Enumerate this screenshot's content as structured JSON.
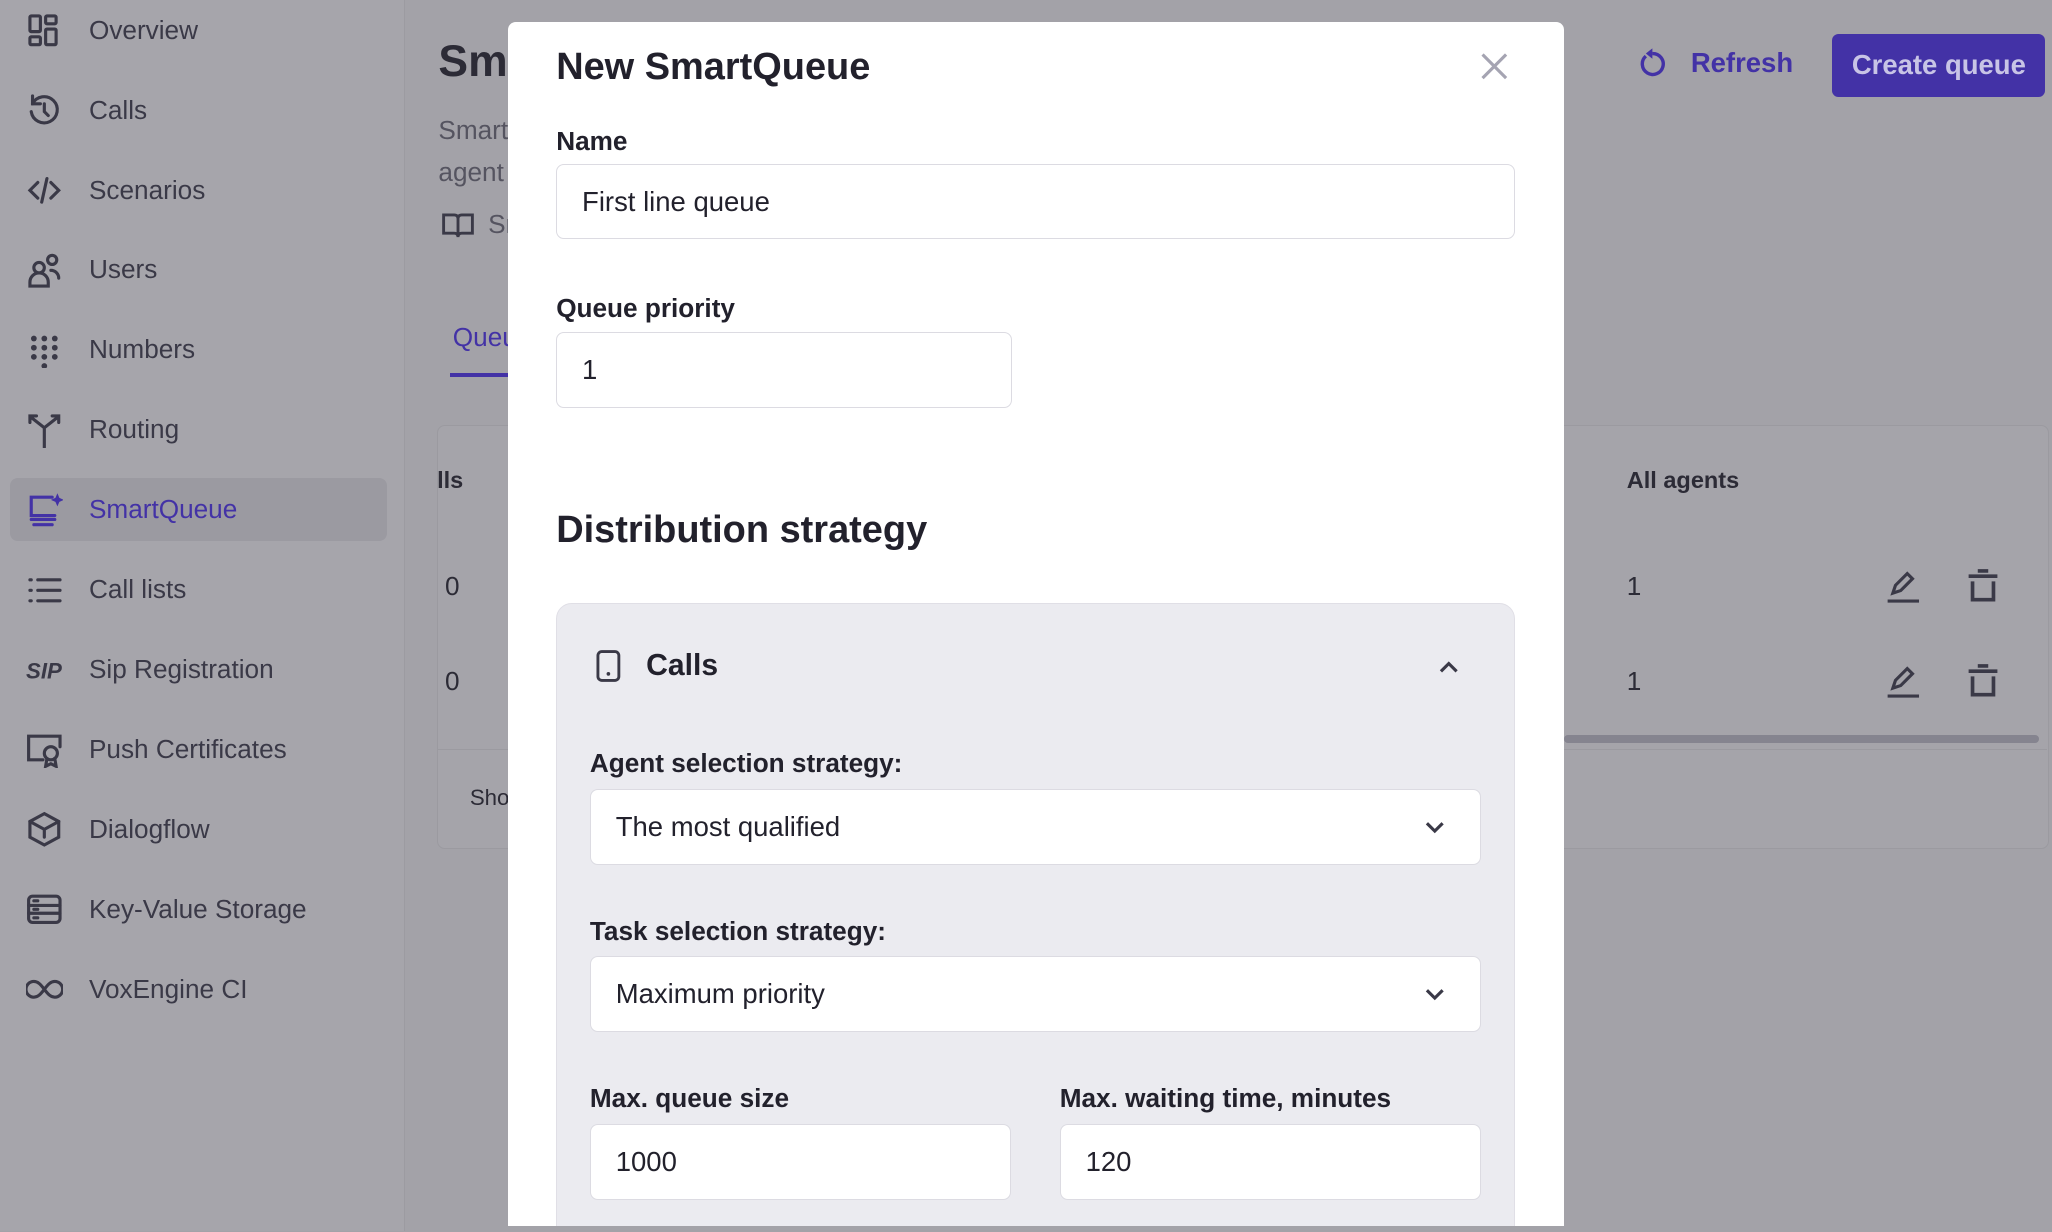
{
  "sidebar": {
    "items": [
      {
        "label": "Overview",
        "icon": "overview-icon"
      },
      {
        "label": "Calls",
        "icon": "history-icon"
      },
      {
        "label": "Scenarios",
        "icon": "code-icon"
      },
      {
        "label": "Users",
        "icon": "users-icon"
      },
      {
        "label": "Numbers",
        "icon": "dialpad-icon"
      },
      {
        "label": "Routing",
        "icon": "routing-icon"
      },
      {
        "label": "SmartQueue",
        "icon": "smartqueue-icon",
        "active": true
      },
      {
        "label": "Call lists",
        "icon": "list-icon"
      },
      {
        "label": "Sip Registration",
        "icon": "sip-icon"
      },
      {
        "label": "Push Certificates",
        "icon": "certificate-icon"
      },
      {
        "label": "Dialogflow",
        "icon": "dialogflow-icon"
      },
      {
        "label": "Key-Value Storage",
        "icon": "storage-icon"
      },
      {
        "label": "VoxEngine CI",
        "icon": "infinity-icon"
      }
    ]
  },
  "page": {
    "title": "Sm",
    "subtitle_line1": "Smart",
    "subtitle_line2": "agent",
    "doc_link": "Sr",
    "tab": "Queu",
    "refresh": "Refresh",
    "create": "Create queue",
    "accent": "#4332a6"
  },
  "table": {
    "col_calls": "lls",
    "col_all_agents": "All agents",
    "rows": [
      {
        "calls": "0",
        "all_agents": "1"
      },
      {
        "calls": "0",
        "all_agents": "1"
      }
    ],
    "footer": "Sho"
  },
  "modal": {
    "title": "New SmartQueue",
    "name_label": "Name",
    "name_value": "First line queue",
    "priority_label": "Queue priority",
    "priority_value": "1",
    "distribution_heading": "Distribution strategy",
    "calls_panel": {
      "title": "Calls",
      "expanded": true,
      "agent_label": "Agent selection strategy:",
      "agent_value": "The most qualified",
      "task_label": "Task selection strategy:",
      "task_value": "Maximum priority",
      "max_size_label": "Max. queue size",
      "max_size_value": "1000",
      "max_wait_label": "Max. waiting time, minutes",
      "max_wait_value": "120"
    }
  }
}
